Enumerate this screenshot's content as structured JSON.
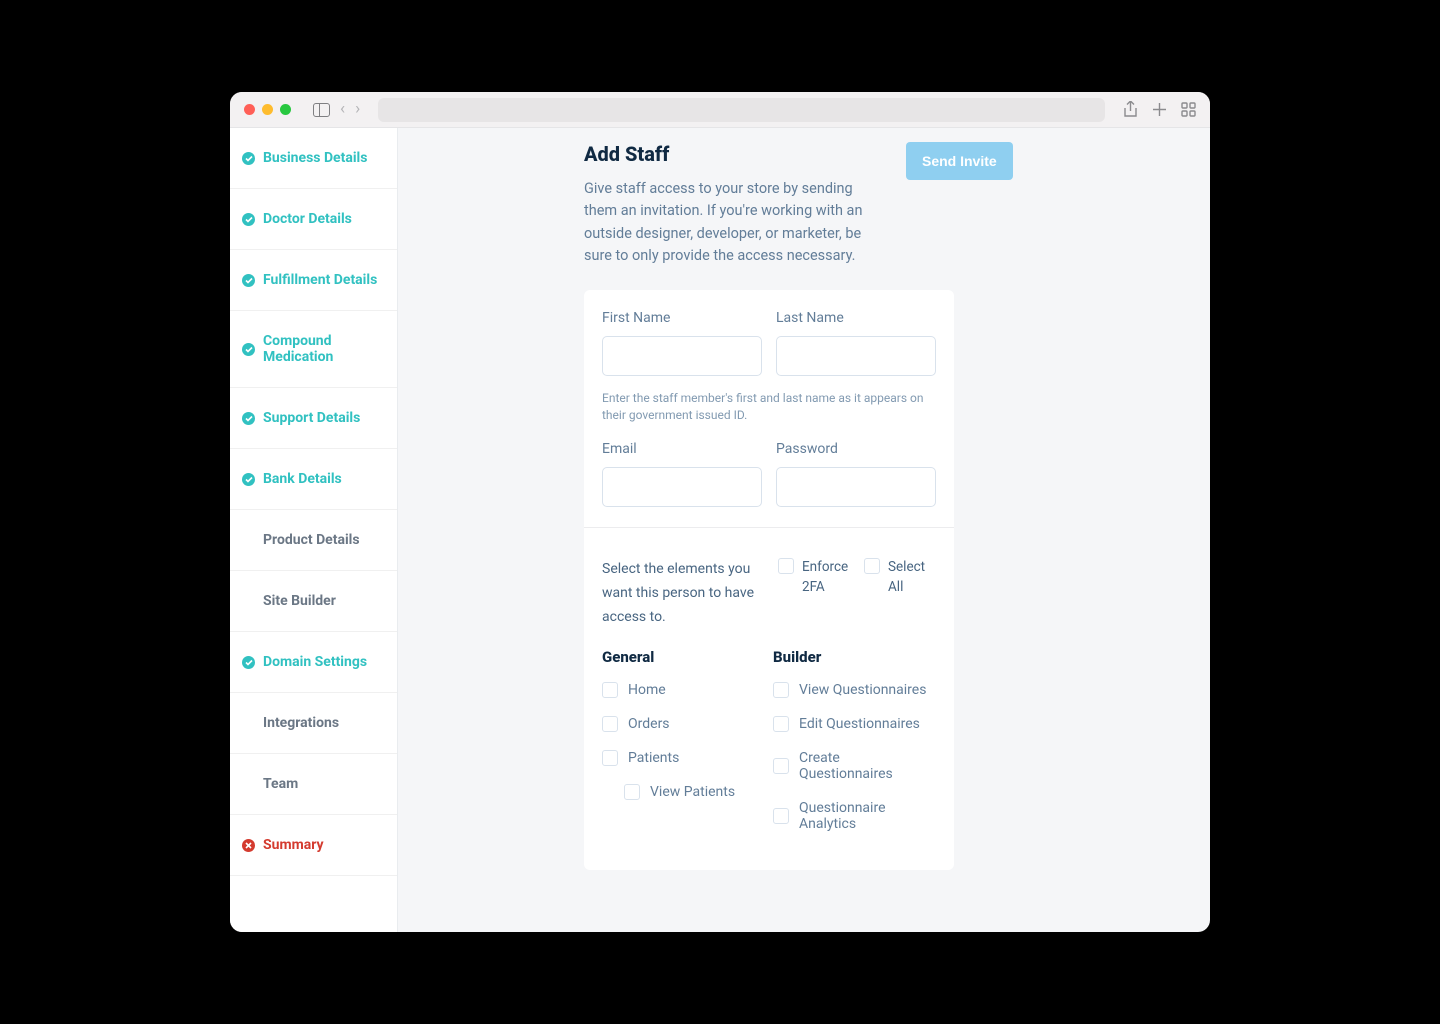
{
  "sidebar": {
    "items": [
      {
        "label": "Business Details",
        "status": "done"
      },
      {
        "label": "Doctor Details",
        "status": "done"
      },
      {
        "label": "Fulfillment Details",
        "status": "done"
      },
      {
        "label": "Compound Medication",
        "status": "done"
      },
      {
        "label": "Support Details",
        "status": "done"
      },
      {
        "label": "Bank Details",
        "status": "done"
      },
      {
        "label": "Product Details",
        "status": "plain"
      },
      {
        "label": "Site Builder",
        "status": "plain"
      },
      {
        "label": "Domain Settings",
        "status": "done"
      },
      {
        "label": "Integrations",
        "status": "plain"
      },
      {
        "label": "Team",
        "status": "plain"
      },
      {
        "label": "Summary",
        "status": "error"
      }
    ]
  },
  "page": {
    "title": "Add Staff",
    "description": "Give staff access to your store by sending them an invitation. If you're working with an outside designer, developer, or marketer, be sure to only provide the access necessary.",
    "invite_button": "Send Invite"
  },
  "form": {
    "first_name_label": "First Name",
    "last_name_label": "Last Name",
    "name_help": "Enter the staff member's first and last name as it appears on their government issued ID.",
    "email_label": "Email",
    "password_label": "Password"
  },
  "permissions": {
    "instructions": "Select the elements you want this person to have access to.",
    "enforce_2fa_label": "Enforce 2FA",
    "select_all_label": "Select All",
    "groups": [
      {
        "title": "General",
        "items": [
          {
            "label": "Home",
            "indent": false
          },
          {
            "label": "Orders",
            "indent": false
          },
          {
            "label": "Patients",
            "indent": false
          },
          {
            "label": "View Patients",
            "indent": true
          }
        ]
      },
      {
        "title": "Builder",
        "items": [
          {
            "label": "View Questionnaires",
            "indent": false
          },
          {
            "label": "Edit Questionnaires",
            "indent": false
          },
          {
            "label": "Create Questionnaires",
            "indent": false
          },
          {
            "label": "Questionnaire Analytics",
            "indent": false
          }
        ]
      }
    ]
  }
}
